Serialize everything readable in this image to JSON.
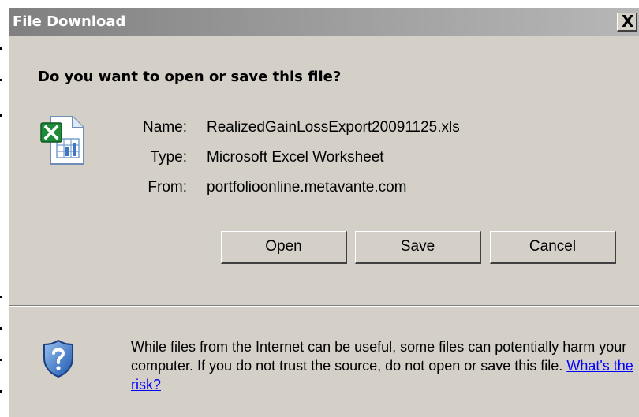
{
  "window": {
    "title": "File Download",
    "close_glyph": "X"
  },
  "question": "Do you want to open or save this file?",
  "file": {
    "icon": "excel-file-icon",
    "name_label": "Name:",
    "name_value": "RealizedGainLossExport20091125.xls",
    "type_label": "Type:",
    "type_value": "Microsoft Excel Worksheet",
    "from_label": "From:",
    "from_value": "portfolioonline.metavante.com"
  },
  "buttons": {
    "open": "Open",
    "save": "Save",
    "cancel": "Cancel"
  },
  "warning": {
    "icon": "shield-question-icon",
    "text": "While files from the Internet can be useful, some files can potentially harm your computer. If you do not trust the source, do not open or save this file. ",
    "link": "What's the risk?"
  },
  "colors": {
    "dialog_bg": "#d4d0c8",
    "title_bar_start": "#808080",
    "title_bar_end": "#b7b7b7",
    "link": "#0000ff"
  }
}
